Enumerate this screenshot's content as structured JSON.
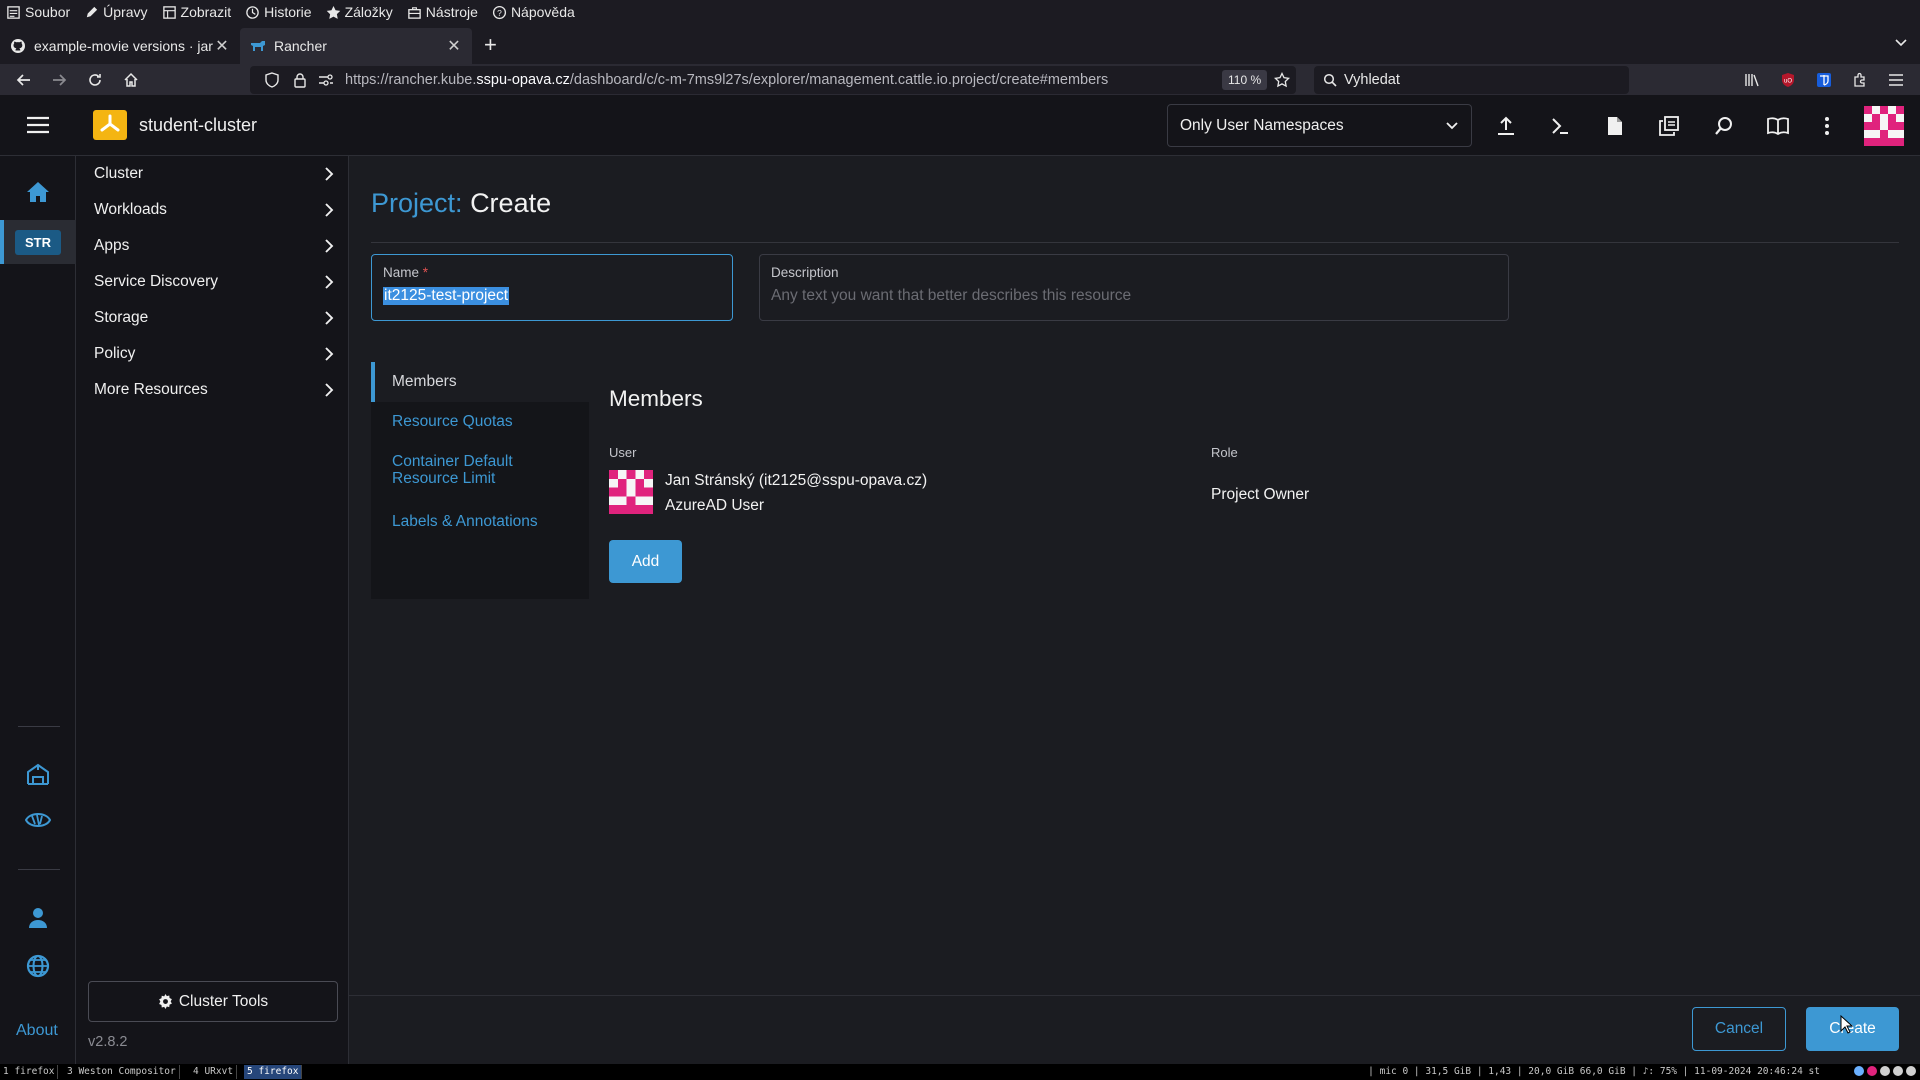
{
  "menubar": {
    "items": [
      {
        "label": "Soubor",
        "icon": "file-menu-icon"
      },
      {
        "label": "Úpravy",
        "icon": "pencil-icon"
      },
      {
        "label": "Zobrazit",
        "icon": "view-icon"
      },
      {
        "label": "Historie",
        "icon": "clock-icon"
      },
      {
        "label": "Záložky",
        "icon": "star-icon"
      },
      {
        "label": "Nástroje",
        "icon": "toolbox-icon"
      },
      {
        "label": "Nápověda",
        "icon": "help-icon"
      }
    ]
  },
  "browser": {
    "tabs": [
      {
        "title": "example-movie versions · jar",
        "icon": "github-icon",
        "active": false
      },
      {
        "title": "Rancher",
        "icon": "rancher-favicon",
        "active": true
      }
    ],
    "url_prefix": "https://rancher.kube.",
    "url_host": "sspu-opava.cz",
    "url_path": "/dashboard/c/c-m-7ms9l27s/explorer/management.cattle.io.project/create#members",
    "zoom": "110 %",
    "search_placeholder": "Vyhledat"
  },
  "header": {
    "cluster_name": "student-cluster",
    "namespace_filter": "Only User Namespaces",
    "icons": [
      "upload-icon",
      "kubectl-shell-icon",
      "file-icon",
      "copy-config-icon",
      "search-icon",
      "book-icon",
      "more-vertical-icon"
    ]
  },
  "rail": {
    "cluster_abbrev": "STR",
    "about": "About"
  },
  "sidenav": {
    "groups": [
      {
        "label": "Cluster"
      },
      {
        "label": "Workloads"
      },
      {
        "label": "Apps"
      },
      {
        "label": "Service Discovery"
      },
      {
        "label": "Storage"
      },
      {
        "label": "Policy"
      },
      {
        "label": "More Resources"
      }
    ],
    "cluster_tools": "Cluster Tools",
    "version": "v2.8.2"
  },
  "page": {
    "title_prefix": "Project:",
    "title_action": "Create",
    "name_label": "Name",
    "name_required": "*",
    "name_value": "it2125-test-project",
    "description_label": "Description",
    "description_placeholder": "Any text you want that better describes this resource",
    "tabs": [
      {
        "label": "Members",
        "active": true
      },
      {
        "label": "Resource Quotas"
      },
      {
        "label": "Container Default Resource Limit"
      },
      {
        "label": "Labels & Annotations"
      }
    ],
    "members": {
      "heading": "Members",
      "col_user": "User",
      "col_role": "Role",
      "rows": [
        {
          "name": "Jan Stránský (it2125@sspu-opava.cz)",
          "type": "AzureAD User",
          "role": "Project Owner"
        }
      ],
      "add_label": "Add"
    },
    "cancel_label": "Cancel",
    "create_label": "Create"
  },
  "statusbar": {
    "workspaces": [
      "1 firefox",
      "3 Weston Compositor",
      "4 URxvt",
      "5 firefox"
    ],
    "info": "| mic 0 | 31,5 GiB | 1,43 | 20,0 GiB 66,0 GiB | ♪: 75% | 11-09-2024 20:46:24 st"
  },
  "colors": {
    "accent": "#3d98d3",
    "cluster_badge": "#f4b512",
    "avatar_pink": "#e0237d",
    "background": "#1b1c21"
  }
}
